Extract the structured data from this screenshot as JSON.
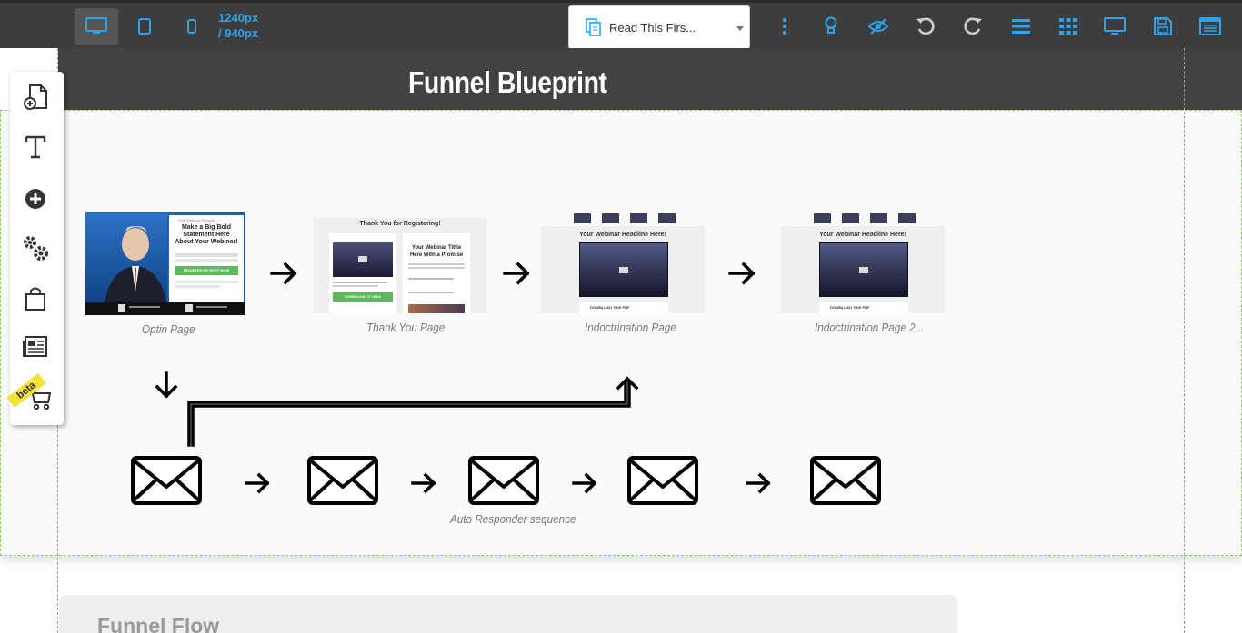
{
  "toolbar": {
    "devices": [
      "desktop-view",
      "tablet-view",
      "mobile-view"
    ],
    "width_text": "1240px",
    "height_text": "/ 940px",
    "page_select": {
      "value": "Read This Firs..."
    },
    "tools": [
      "more-icon",
      "lightbulb-icon",
      "visibility-icon",
      "undo-icon",
      "redo-icon",
      "menu-icon",
      "grid-icon",
      "monitor-icon",
      "save-icon",
      "browser-icon"
    ],
    "accent_color": "#2ba3ef"
  },
  "section": {
    "title": "Funnel Blueprint"
  },
  "left_panel": {
    "items": [
      "add-page-icon",
      "text-icon",
      "add-element-icon",
      "settings-icon",
      "shopping-bag-icon",
      "newsletter-icon",
      "cart-icon"
    ],
    "beta_label": "beta"
  },
  "pages": [
    {
      "caption": "Optin Page",
      "mini_lines": [
        "Make a Big Bold",
        "Statement Here",
        "About Your Webinar!"
      ],
      "mini_button": "REGISTER MY SPOT NOW"
    },
    {
      "caption": "Thank You Page",
      "mini_title": "Thank You for Registering!",
      "mini_right": [
        "Your Webinar Tittle",
        "Here With a Promise"
      ],
      "mini_button": "DOWNLOAD IT NOW"
    },
    {
      "caption": "Indoctrination Page",
      "mini_title": "Your Webinar Headline Here!",
      "mini_button": "DOWNLOAD THIS PDF"
    },
    {
      "caption": "Indoctrination Page 2...",
      "mini_title": "Your Webinar Headline Here!",
      "mini_button": "DOWNLOAD THIS PDF"
    }
  ],
  "autoresponder": {
    "caption": "Auto Responder sequence",
    "email_count": 5
  },
  "flow_card": {
    "title": "Funnel Flow"
  }
}
